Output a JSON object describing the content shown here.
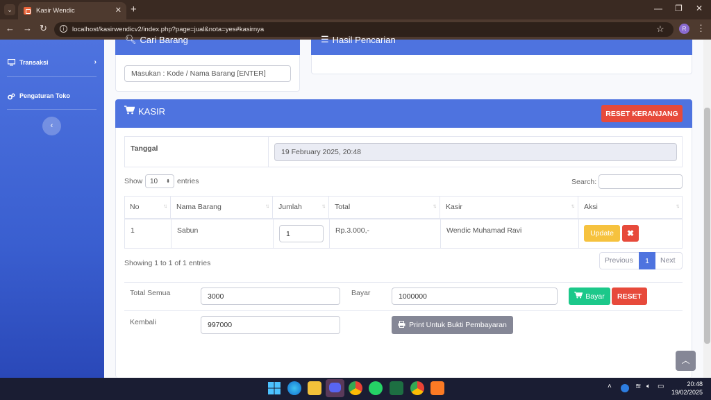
{
  "browser": {
    "tab_title": "Kasir Wendic",
    "url": "localhost/kasirwendicv2/index.php?page=jual&nota=yes#kasirnya",
    "profile_initial": "R"
  },
  "sidebar": {
    "items": [
      {
        "label": "Transaksi",
        "icon": "monitor-icon"
      },
      {
        "label": "Pengaturan Toko",
        "icon": "cogs-icon"
      }
    ]
  },
  "cari_barang": {
    "title": "Cari Barang",
    "placeholder": "Masukan : Kode / Nama Barang  [ENTER]"
  },
  "hasil_pencarian": {
    "title": "Hasil Pencarian"
  },
  "kasir": {
    "title": "KASIR",
    "reset_cart_label": "RESET KERANJANG",
    "tanggal_label": "Tanggal",
    "tanggal_value": "19 February 2025, 20:48",
    "show_label": "Show",
    "entries_value": "10",
    "entries_label": "entries",
    "search_label": "Search:",
    "columns": [
      "No",
      "Nama Barang",
      "Jumlah",
      "Total",
      "Kasir",
      "Aksi"
    ],
    "rows": [
      {
        "no": "1",
        "nama": "Sabun",
        "jumlah": "1",
        "total": "Rp.3.000,-",
        "kasir": "Wendic Muhamad Ravi"
      }
    ],
    "update_label": "Update",
    "showing_text": "Showing 1 to 1 of 1 entries",
    "pagination": {
      "previous": "Previous",
      "page": "1",
      "next": "Next"
    },
    "total_semua_label": "Total Semua",
    "total_semua_value": "3000",
    "bayar_label": "Bayar",
    "bayar_value": "1000000",
    "bayar_button": "Bayar",
    "reset_button": "RESET",
    "kembali_label": "Kembali",
    "kembali_value": "997000",
    "print_button": "Print Untuk Bukti Pembayaran"
  },
  "taskbar": {
    "time": "20:48",
    "date": "19/02/2025"
  },
  "colors": {
    "primary": "#4e73df",
    "danger": "#e74a3b",
    "success": "#1cc88a",
    "warning": "#f6c23e",
    "secondary": "#858796"
  }
}
